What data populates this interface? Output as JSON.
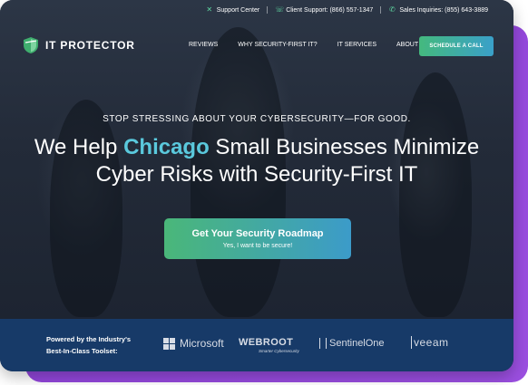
{
  "utility_bar": {
    "support": "Support Center",
    "client_support": "Client Support: (866) 557-1347",
    "sales": "Sales Inquiries: (855) 643-3889"
  },
  "brand": {
    "name": "IT PROTECTOR",
    "accent": "#5ac8dc",
    "green": "#44b97e"
  },
  "nav": {
    "items": [
      "REVIEWS",
      "WHY SECURITY-FIRST IT?",
      "IT SERVICES",
      "ABOUT"
    ],
    "cta": "SCHEDULE A CALL"
  },
  "hero": {
    "eyebrow": "STOP STRESSING ABOUT YOUR CYBERSECURITY—FOR GOOD.",
    "headline_pre": "We Help ",
    "headline_highlight": "Chicago",
    "headline_post": " Small Businesses Minimize",
    "headline_line2": "Cyber Risks with Security-First IT",
    "button_title": "Get Your Security Roadmap",
    "button_subtitle": "Yes, I want to be secure!"
  },
  "partners": {
    "intro_line1": "Powered by the Industry's",
    "intro_line2": "Best-In-Class Toolset:",
    "microsoft": "Microsoft",
    "webroot": "WEBROOT",
    "webroot_tagline": "Smarter Cybersecurity",
    "sentinelone": "SentinelOne",
    "veeam": "veeam"
  }
}
